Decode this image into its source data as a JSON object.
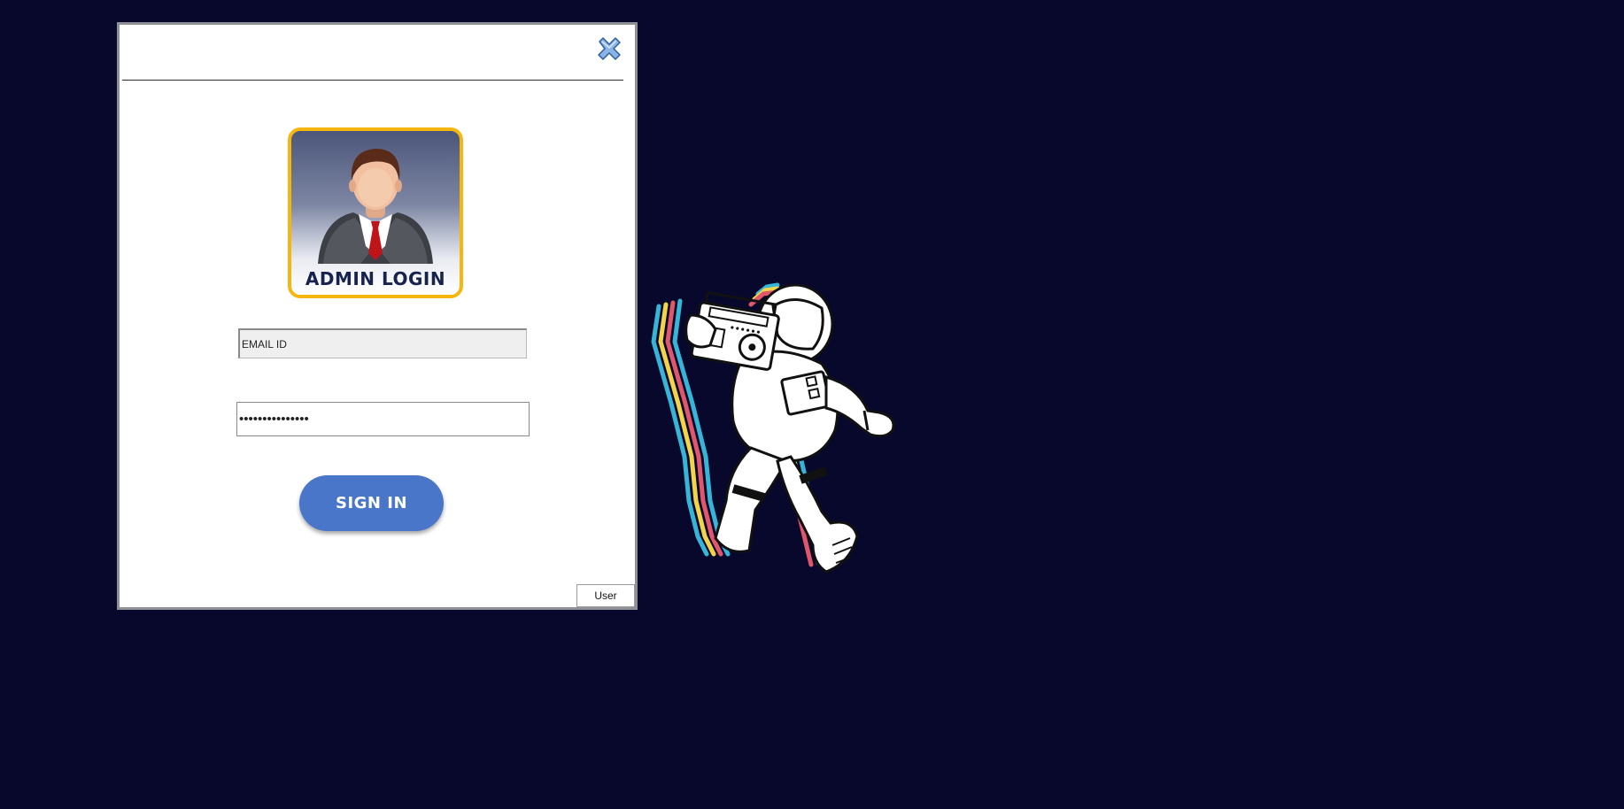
{
  "window": {
    "close_icon": "close-x-icon",
    "badge_title": "ADMIN LOGIN",
    "email_placeholder": "EMAIL ID",
    "email_value": "",
    "password_value": "•••••••••••••••",
    "signin_label": "SIGN IN",
    "user_label": "User"
  },
  "colors": {
    "background": "#07082b",
    "signin_button": "#4a76c9",
    "badge_border": "#f5b70f",
    "badge_title": "#17234d"
  },
  "illustration": {
    "icon": "astronaut-boombox-illustration"
  }
}
